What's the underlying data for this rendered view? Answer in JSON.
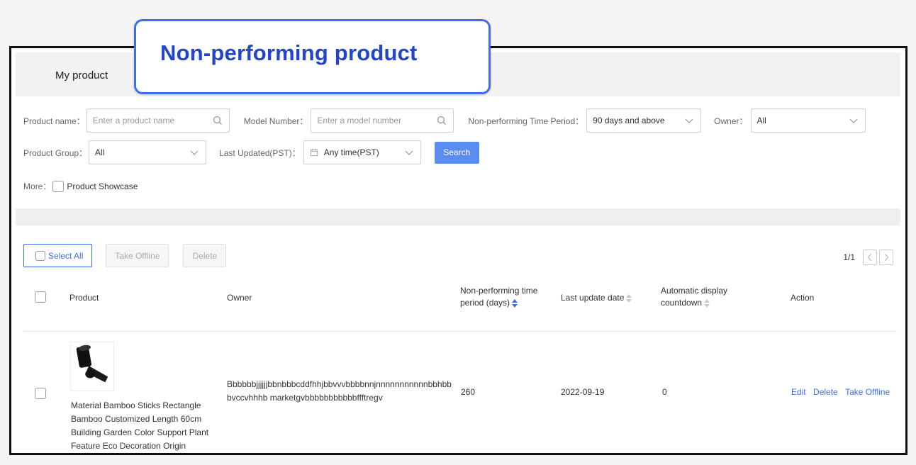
{
  "callout": {
    "text": "Non-performing product"
  },
  "header": {
    "title": "My product"
  },
  "filters": {
    "product_name": {
      "label": "Product name：",
      "placeholder": "Enter a product name"
    },
    "model_number": {
      "label": "Model Number：",
      "placeholder": "Enter a model number"
    },
    "time_period": {
      "label": "Non-performing Time Period：",
      "value": "90 days and above"
    },
    "owner": {
      "label": "Owner：",
      "value": "All"
    },
    "product_group": {
      "label": "Product Group：",
      "value": "All"
    },
    "last_updated": {
      "label": "Last Updated(PST)：",
      "value": "Any time(PST)"
    },
    "search_label": "Search",
    "more_label": "More：",
    "showcase_label": "Product Showcase"
  },
  "actions": {
    "select_all": "Select All",
    "take_offline": "Take Offline",
    "delete": "Delete"
  },
  "pager": {
    "text": "1/1"
  },
  "table": {
    "headers": {
      "product": "Product",
      "owner": "Owner",
      "period_line1": "Non-performing time",
      "period_line2": "period (days)",
      "last_update": "Last update date",
      "countdown_line1": "Automatic display",
      "countdown_line2": "countdown",
      "action": "Action"
    },
    "rows": [
      {
        "product": "Material Bamboo Sticks Rectangle Bamboo Customized Length 60cm Building Garden Color Support Plant Feature Eco Decoration Origin",
        "owner": "Bbbbbbjjjjjjbbnbbbcddfhhjbbvvvbbbbnnjnnnnnnnnnnnbbhbbbvccvhhhb marketgvbbbbbbbbbbbffftregv",
        "period": "260",
        "last_update": "2022-09-19",
        "countdown": "0",
        "edit": "Edit",
        "delete": "Delete",
        "take_offline": "Take Offline"
      }
    ]
  },
  "colors": {
    "accent": "#3d6ef2",
    "callout_text": "#2346c8",
    "search_btn": "#5b8cf3"
  }
}
